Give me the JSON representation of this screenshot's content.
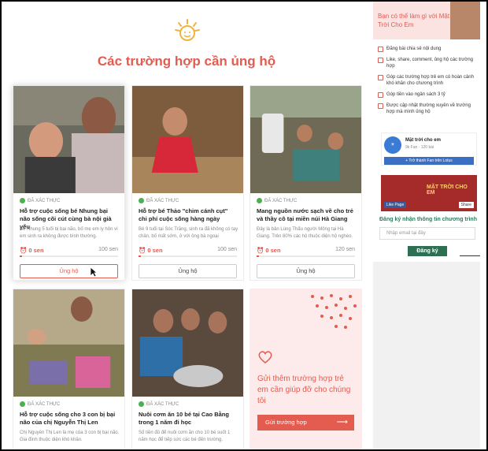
{
  "header": {
    "title": "Các trường hợp cần ủng hộ"
  },
  "cards": [
    {
      "verified": "ĐÃ XÁC THỰC",
      "title": "Hỗ trợ cuộc sống bé Nhung bại não sống cõi cút cùng bà nội già yếu",
      "desc": "Bé Nhung 5 tuổi bị bại não, bố mẹ em ly hôn vì em sinh ra không được bình thường.",
      "raised": "0 sen",
      "goal": "100 sen",
      "button": "Ủng hộ"
    },
    {
      "verified": "ĐÃ XÁC THỰC",
      "title": "Hỗ trợ bé Thảo \"chim cánh cụt\" chi phí cuộc sống hàng ngày",
      "desc": "Bé 9 tuổi tại Sóc Trăng, sinh ra đã không có tay chân, bố mất sớm, ở với ông bà ngoại",
      "raised": "0 sen",
      "goal": "100 sen",
      "button": "Ủng hộ"
    },
    {
      "verified": "ĐÃ XÁC THỰC",
      "title": "Mang nguồn nước sạch về cho trẻ và thầy cô tại miền núi Hà Giang",
      "desc": "Đây là bản Lùng Thẩu người Mông tại Hà Giang. Trên 80% các hộ thuộc diện hộ nghèo.",
      "raised": "0 sen",
      "goal": "120 sen",
      "button": "Ủng hộ"
    },
    {
      "verified": "ĐÃ XÁC THỰC",
      "title": "Hỗ trợ cuộc sống cho 3 con bị bại não của chị Nguyễn Thị Len",
      "desc": "Chị Nguyễn Thị Len là mẹ của 3 con bị bại não. Gia đình thuộc diện khó khăn.",
      "raised": "",
      "goal": "",
      "button": ""
    },
    {
      "verified": "ĐÃ XÁC THỰC",
      "title": "Nuôi cơm ăn 10 bé tại Cao Bằng trong 1 năm đi học",
      "desc": "Số tiền đủ để nuôi cơm ăn cho 10 bé suốt 1 năm học để tiếp sức các bé đến trường.",
      "raised": "",
      "goal": "",
      "button": ""
    }
  ],
  "promo": {
    "text": "Gửi thêm trường hợp trẻ em cần giúp đỡ cho chúng tôi",
    "button": "Gửi trường hợp"
  },
  "sidebar": {
    "banner": "Bạn có thể làm gì với Mặt Trời Cho Em",
    "items": [
      "Đăng bài chia sẻ nội dung",
      "Like, share, comment, ủng hộ các trường hợp",
      "Góp các trường hợp trẻ em có hoàn cảnh khó khăn cho chương trình",
      "Góp tiền vào ngân sách 3 tỷ",
      "Được cập nhật thường xuyên về trường hợp mà mình ủng hộ"
    ],
    "fb": {
      "name": "Mặt trời cho em",
      "fans": "9k Fan  ·  120 bài",
      "follow": "+ Trở thành Fan trên Lotus"
    },
    "cover": {
      "text": "MẶT TRỜI CHO EM",
      "like": "Like Page",
      "share": "Share"
    },
    "subscribe_title": "Đăng ký nhận thông tin chương trình",
    "email_placeholder": "Nhập email tại đây",
    "register": "Đăng ký"
  },
  "colors": {
    "accent": "#e45b4f",
    "green": "#2e6e52"
  }
}
